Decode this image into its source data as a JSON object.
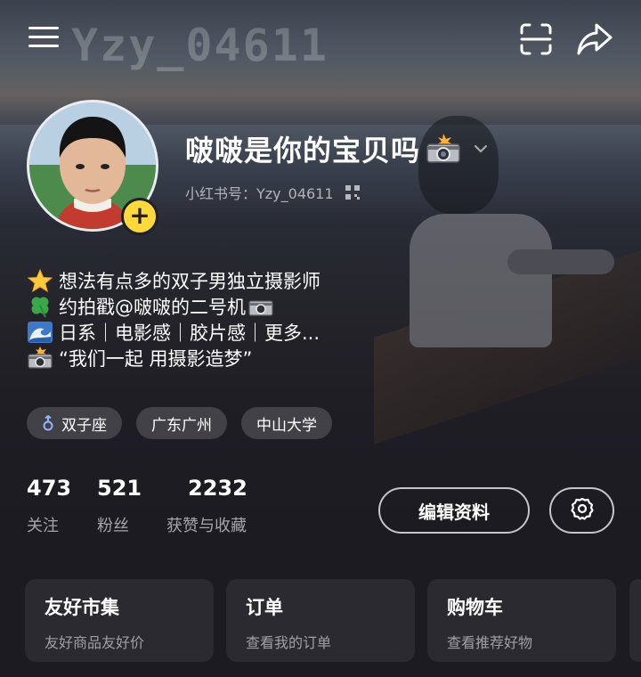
{
  "topbar": {
    "watermark": "Yzy_04611",
    "menu_icon": "menu-icon",
    "scan_icon": "scan-icon",
    "share_icon": "share-icon"
  },
  "profile": {
    "nickname": "啵啵是你的宝贝吗",
    "redbook_id": "小红书号：Yzy_04611",
    "add_badge": "+"
  },
  "bio": [
    {
      "emoji": "star-icon",
      "text": "想法有点多的双子男独立摄影师"
    },
    {
      "emoji": "clover-icon",
      "text": "约拍戳@啵啵的二号机"
    },
    {
      "emoji": "wave-icon",
      "text": "日系｜电影感｜胶片感｜更多..."
    },
    {
      "emoji": "camera-flash-icon",
      "text": "“我们一起 用摄影造梦”"
    }
  ],
  "tags": [
    "双子座",
    "广东广州",
    "中山大学"
  ],
  "stats": [
    {
      "value": "473",
      "label": "关注"
    },
    {
      "value": "521",
      "label": "粉丝"
    },
    {
      "value": "2232",
      "label": "获赞与收藏"
    }
  ],
  "actions": {
    "edit_profile": "编辑资料",
    "settings_icon": "gear-icon"
  },
  "cards": [
    {
      "title": "友好市集",
      "subtitle": "友好商品友好价"
    },
    {
      "title": "订单",
      "subtitle": "查看我的订单"
    },
    {
      "title": "购物车",
      "subtitle": "查看推荐好物"
    }
  ],
  "colors": {
    "background": "#1c1b22",
    "card": "#2b2a31",
    "badge_yellow": "#ffd83a"
  }
}
